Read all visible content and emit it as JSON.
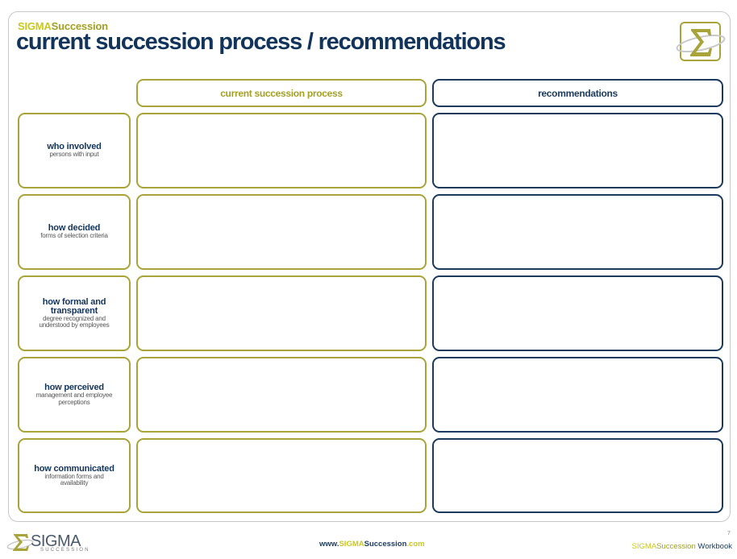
{
  "header": {
    "brand_prefix": "SIGMA",
    "brand_suffix": "Succession",
    "title": "current succession process / recommendations"
  },
  "logo": {
    "icon": "sigma-icon"
  },
  "columns": [
    {
      "label": "current succession process"
    },
    {
      "label": "recommendations"
    }
  ],
  "rows": [
    {
      "label": "who involved",
      "sublabel": "persons with input",
      "current": "",
      "recommendation": ""
    },
    {
      "label": "how decided",
      "sublabel": "forms of selection criteria",
      "current": "",
      "recommendation": ""
    },
    {
      "label": "how formal and transparent",
      "sublabel": "degree recognized and understood by employees",
      "current": "",
      "recommendation": ""
    },
    {
      "label": "how perceived",
      "sublabel": "management and employee perceptions",
      "current": "",
      "recommendation": ""
    },
    {
      "label": "how communicated",
      "sublabel": "information forms and availability",
      "current": "",
      "recommendation": ""
    }
  ],
  "footer": {
    "logo_text": "SIGMA",
    "logo_subtext": "SUCCESSION",
    "url_prefix": "www.",
    "url_brand": "SIGMA",
    "url_suffix": "Succession",
    "url_tld": ".com",
    "page_number": "7",
    "workbook_prefix": "SIGMA",
    "workbook_mid": "Succession",
    "workbook_suffix": " Workbook"
  },
  "colors": {
    "navy": "#12345a",
    "olive": "#a9a43a",
    "lime": "#c8c81e"
  }
}
